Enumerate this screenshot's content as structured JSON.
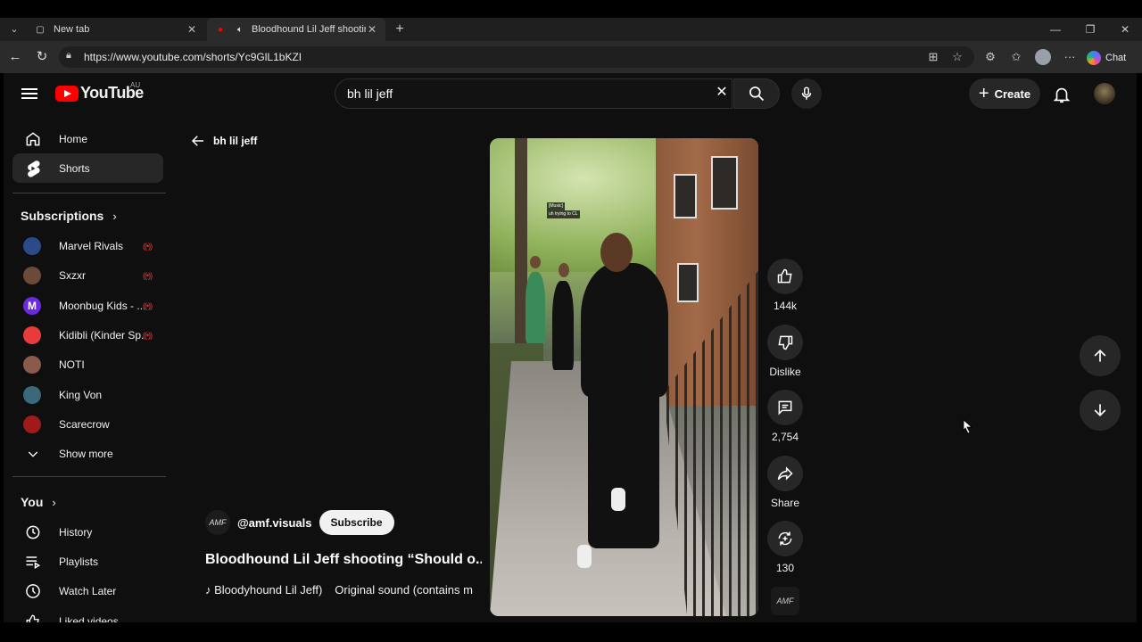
{
  "browser": {
    "tabs": [
      {
        "title": "New tab"
      },
      {
        "title": "Bloodhound Lil Jeff shooting"
      }
    ],
    "url": "https://www.youtube.com/shorts/Yc9GlL1bKZI",
    "chat_label": "Chat"
  },
  "header": {
    "logo_text": "YouTube",
    "region": "AU",
    "search_value": "bh lil jeff",
    "create_label": "Create"
  },
  "sidebar": {
    "main": [
      {
        "label": "Home",
        "icon": "home-icon"
      },
      {
        "label": "Shorts",
        "icon": "shorts-icon",
        "active": true
      }
    ],
    "subscriptions_title": "Subscriptions",
    "subscriptions": [
      {
        "label": "Marvel Rivals",
        "live": true,
        "color": "#2a4a8a"
      },
      {
        "label": "Sxzxr",
        "live": true,
        "color": "#6b4a3a"
      },
      {
        "label": "Moonbug Kids - ...",
        "live": true,
        "color": "#6a2be0"
      },
      {
        "label": "Kidibli (Kinder Sp...",
        "live": true,
        "color": "#e83b3b"
      },
      {
        "label": "NOTI",
        "live": false,
        "color": "#8a5a4a"
      },
      {
        "label": "King Von",
        "live": false,
        "color": "#3a6a7a"
      },
      {
        "label": "Scarecrow",
        "live": false,
        "color": "#a01a1a"
      }
    ],
    "show_more": "Show more",
    "you_title": "You",
    "you": [
      {
        "label": "History",
        "icon": "history-icon"
      },
      {
        "label": "Playlists",
        "icon": "playlists-icon"
      },
      {
        "label": "Watch Later",
        "icon": "watch-later-icon"
      },
      {
        "label": "Liked videos",
        "icon": "like-icon"
      }
    ]
  },
  "back_label": "bh lil jeff",
  "video": {
    "caption_line1": "[Music]",
    "caption_line2": "uh trying to CL",
    "channel_handle": "@amf.visuals",
    "channel_logo": "AMF",
    "subscribe_label": "Subscribe",
    "title": "Bloodhound Lil Jeff shooting “Should o...",
    "sound_artist": "♪ Bloodyhound Lil Jeff)",
    "sound_name": "Original sound (contains m"
  },
  "actions": {
    "likes": "144k",
    "dislike_label": "Dislike",
    "comments": "2,754",
    "share_label": "Share",
    "remix": "130"
  }
}
